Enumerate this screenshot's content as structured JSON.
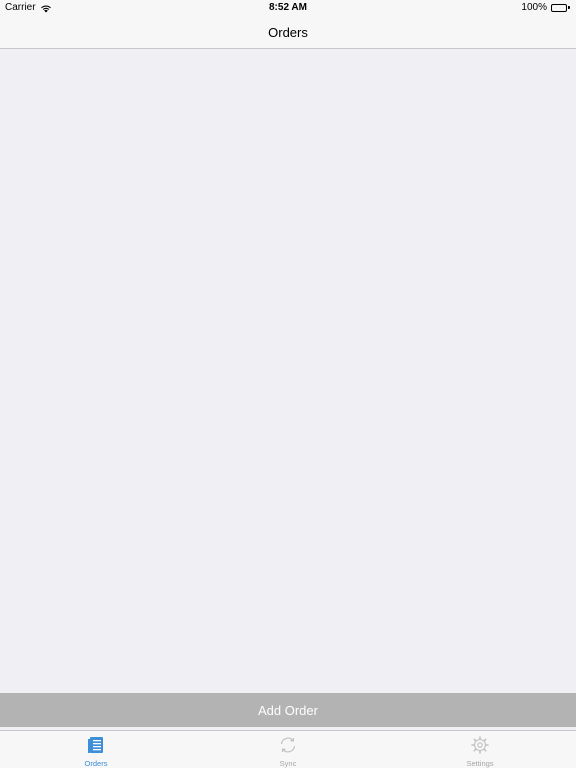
{
  "status_bar": {
    "carrier": "Carrier",
    "time": "8:52 AM",
    "battery": "100%"
  },
  "nav": {
    "title": "Orders"
  },
  "add_order": {
    "label": "Add Order"
  },
  "tabs": [
    {
      "label": "Orders",
      "icon": "orders-list-icon",
      "active": true
    },
    {
      "label": "Sync",
      "icon": "sync-icon",
      "active": false
    },
    {
      "label": "Settings",
      "icon": "gear-icon",
      "active": false
    }
  ],
  "colors": {
    "accent": "#3d8fd9",
    "inactive_tab": "#a6a6a6",
    "background": "#efeff4",
    "button_disabled": "#b3b3b3"
  }
}
